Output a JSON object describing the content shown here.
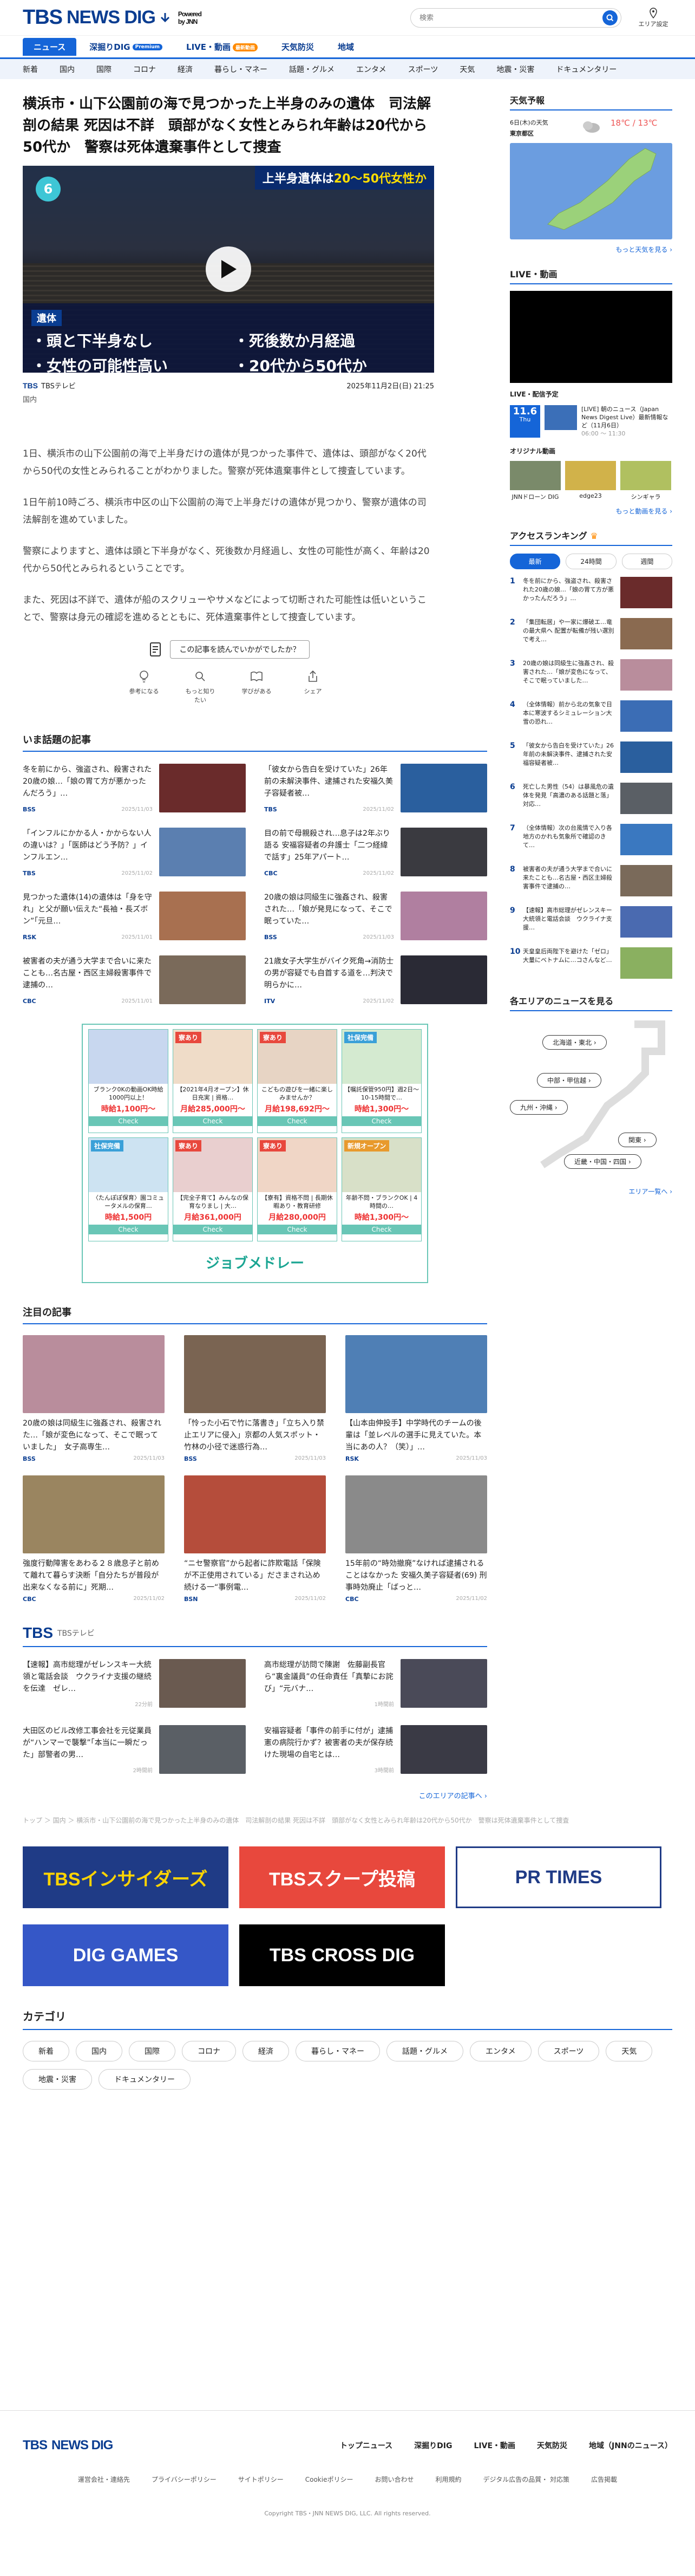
{
  "header": {
    "logo_tbs": "TBS",
    "logo_news": "NEWS DIG",
    "powered": "Powered\nby JNN",
    "search_placeholder": "検索",
    "area_label": "エリア設定"
  },
  "main_nav": [
    {
      "label": "ニュース",
      "active": true
    },
    {
      "label": "深掘りDIG",
      "tag": "Premium",
      "tag_color": "blue"
    },
    {
      "label": "LIVE・動画",
      "tag": "最新動画",
      "tag_color": "orange"
    },
    {
      "label": "天気防災"
    },
    {
      "label": "地域"
    }
  ],
  "sub_nav": [
    "新着",
    "国内",
    "国際",
    "コロナ",
    "経済",
    "暮らし・マネー",
    "話題・グルメ",
    "エンタメ",
    "スポーツ",
    "天気",
    "地震・災害",
    "ドキュメンタリー"
  ],
  "article": {
    "title": "横浜市・山下公園前の海で見つかった上半身のみの遺体　司法解剖の結果 死因は不詳　頭部がなく女性とみられ年齢は20代から50代か　警察は死体遺棄事件として捜査",
    "video": {
      "channel_badge": "6",
      "ticker_pre": "上半身遺体は",
      "ticker_hl": "20～50代女性か",
      "caption_label": "遺体",
      "caption_items": [
        "・頭と下半身なし",
        "・死後数か月経過",
        "・女性の可能性高い",
        "・20代から50代か"
      ]
    },
    "source": "TBS",
    "source_name": "TBSテレビ",
    "datetime": "2025年11月2日(日) 21:25",
    "category": "国内",
    "paragraphs": [
      "1日、横浜市の山下公園前の海で上半身だけの遺体が見つかった事件で、遺体は、頭部がなく20代から50代の女性とみられることがわかりました。警察が死体遺棄事件として捜査しています。",
      "1日午前10時ごろ、横浜市中区の山下公園前の海で上半身だけの遺体が見つかり、警察が遺体の司法解剖を進めていました。",
      "警察によりますと、遺体は頭と下半身がなく、死後数か月経過し、女性の可能性が高く、年齢は20代から50代とみられるということです。",
      "また、死因は不詳で、遺体が船のスクリューやサメなどによって切断された可能性は低いということで、警察は身元の確認を進めるとともに、死体遺棄事件として捜査しています。"
    ],
    "feedback_q": "この記事を読んでいかがでしたか？",
    "feedback_opts": [
      "参考になる",
      "もっと知りたい",
      "学びがある",
      "シェア"
    ]
  },
  "hot_topics": {
    "heading": "いま話題の記事",
    "items": [
      {
        "text": "冬を前にから、強盗され、殺害された20歳の娘…「娘の胃て方が悪かったんだろう」…",
        "src": "BSS",
        "date": "2025/11/03",
        "color": "#6a2b2b"
      },
      {
        "text": "「彼女から告白を受けていた」26年前の未解決事件、逮捕された安福久美子容疑者被…",
        "src": "TBS",
        "date": "2025/11/02",
        "color": "#2a5f9e"
      },
      {
        "text": "「インフルにかかる人・かからない人の違いは？」「医師はどう予防？」インフルエン…",
        "src": "TBS",
        "date": "2025/11/02",
        "color": "#5b7fb0"
      },
      {
        "text": "目の前で母親殺され…息子は2年ぶり語る 安福容疑者の弁護士「二つ経緯で話す」25年アパート…",
        "src": "CBC",
        "date": "2025/11/02",
        "color": "#3a3a40"
      },
      {
        "text": "見つかった遺体(14)の遺体は「身を守れ」と父が願い伝えた“長袖・長ズボン”「元旦…",
        "src": "RSK",
        "date": "2025/11/01",
        "color": "#a87050"
      },
      {
        "text": "20歳の娘は同級生に強姦され、殺害された…「娘が発見になって、そこで眠っていた…",
        "src": "BSS",
        "date": "2025/11/03",
        "color": "#b07fa0"
      },
      {
        "text": "被害者の夫が通う大学まで合いに来たことも…名古屋・西区主婦殺害事件で逮捕の…",
        "src": "CBC",
        "date": "2025/11/01",
        "color": "#7a6a5a"
      },
      {
        "text": "21歳女子大学生がバイク死角→消防士の男が容疑でも自首する道を…判決で明らかに…",
        "src": "ITV",
        "date": "2025/11/02",
        "color": "#2a2a35"
      }
    ]
  },
  "ad": {
    "items": [
      {
        "badge": "",
        "desc": "ブランク0Kの動画OK時給1000円以上！",
        "price": "時給1,100円～",
        "check": "Check",
        "color": "#c8d7ef"
      },
      {
        "badge": "寮あり",
        "desc": "【2021年4月オープン】休日充実 | 資格…",
        "price": "月給285,000円～",
        "check": "Check",
        "color": "#efdcc8"
      },
      {
        "badge": "寮あり",
        "desc": "こどもの遊びを一緒に楽しみませんか？",
        "price": "月給198,692円～",
        "check": "Check",
        "color": "#e7d4c4"
      },
      {
        "badge": "社保完備",
        "desc": "【嘱託保管950円】週2日～ 10-15時間で…",
        "price": "時給1,300円～",
        "check": "Check",
        "color": "#d4ead0"
      },
      {
        "badge": "社保完備",
        "desc": "〈たんぽぽ保育〉園コミュータメルの保育…",
        "price": "時給1,500円",
        "check": "Check",
        "color": "#cde3f2"
      },
      {
        "badge": "寮あり",
        "desc": "【完全子育て】みんなの保育なりまし | 大…",
        "price": "月給361,000円",
        "check": "Check",
        "color": "#e9cfcf"
      },
      {
        "badge": "寮あり",
        "desc": "【寮有】資格不問 | 長期休暇あり・教育研修",
        "price": "月給280,000円",
        "check": "Check",
        "color": "#f0d6c6"
      },
      {
        "badge": "新規オープン",
        "desc": "年齢不問・ブランクOK | 4時間の…",
        "price": "時給1,300円～",
        "check": "Check",
        "color": "#d8e0c8"
      }
    ],
    "logo": "ジョブメドレー"
  },
  "featured": {
    "heading": "注目の記事",
    "items": [
      {
        "text": "20歳の娘は同級生に強姦され、殺害された…「娘が変色になって、そこで眠っていました」　女子高専生…",
        "src": "BSS",
        "date": "2025/11/03",
        "color": "#b98d9c"
      },
      {
        "text": "「怜った小石で竹に落書き」「立ち入り禁止エリアに侵入」京都の人気スポット・竹林の小径で迷惑行為…",
        "src": "BSS",
        "date": "2025/11/03",
        "color": "#7a6452"
      },
      {
        "text": "【山本由伸投手】中学時代のチームの後輩は「並レベルの選手に見えていた。本当にあの人？（笑）」…",
        "src": "RSK",
        "date": "2025/11/03",
        "color": "#4f7fb5"
      },
      {
        "text": "強度行動障害をあわる２８歳息子と前めて離れて暮らす決断「自分たちが普段が出来なくなる前に」死期…",
        "src": "CBC",
        "date": "2025/11/02",
        "color": "#9a8560"
      },
      {
        "text": "“ニセ警察官”から起者に詐欺電話「保険が不正使用されている」ださまされ込め続ける一“事例電…",
        "src": "BSN",
        "date": "2025/11/02",
        "color": "#b54d3b"
      },
      {
        "text": "15年前の“時効撤廃”なければ逮捕されることはなかった 安福久美子容疑者(69) 刑事時効廃止「ばっと…",
        "src": "CBC",
        "date": "2025/11/02",
        "color": "#8a8a8a"
      }
    ]
  },
  "tbs_section": {
    "logo": "TBS",
    "sub": "TBSテレビ",
    "items": [
      {
        "text": "【速報】高市総理がゼレンスキー大統領と電話会談　ウクライナ支援の継続を伝達　ゼレ…",
        "date": "22分前",
        "color": "#6a5a50"
      },
      {
        "text": "高市総理が訪問で陳謝　佐藤副長官ら“裏金議員”の任命責任「真摯にお詫び」“元バナ…",
        "date": "1時間前",
        "color": "#4a4a58"
      },
      {
        "text": "大田区のビル改修工事会社を元従業員が“ハンマーで襲撃”「本当に一瞬だった」部警者の男…",
        "date": "2時間前",
        "color": "#5a5f65"
      },
      {
        "text": "安福容疑者「事件の前手に付が」逮捕憲の病院行かず？被害者の夫が保存続けた現場の自宅とは…",
        "date": "3時間前",
        "color": "#3a3a45"
      }
    ],
    "more": "このエリアの記事へ ›"
  },
  "breadcrumb": "トップ ＞ 国内 ＞ 横浜市・山下公園前の海で見つかった上半身のみの遺体　司法解剖の結果 死因は不詳　頭部がなく女性とみられ年齢は20代から50代か　警察は死体遺棄事件として捜査",
  "banners": [
    {
      "label": "TBSインサイダーズ",
      "bg": "#1f3b86",
      "fg": "#ffd400"
    },
    {
      "label": "TBSスクープ投稿",
      "bg": "#e8483d",
      "fg": "#ffffff"
    },
    {
      "label": "PR TIMES",
      "bg": "#ffffff",
      "fg": "#1f3b86"
    },
    {
      "label": "DIG GAMES",
      "bg": "#3557c7",
      "fg": "#ffffff"
    },
    {
      "label": "TBS CROSS DIG",
      "bg": "#000000",
      "fg": "#ffffff"
    }
  ],
  "categories": {
    "heading": "カテゴリ",
    "chips": [
      "新着",
      "国内",
      "国際",
      "コロナ",
      "経済",
      "暮らし・マネー",
      "話題・グルメ",
      "エンタメ",
      "スポーツ",
      "天気",
      "地震・災害",
      "ドキュメンタリー"
    ]
  },
  "footer": {
    "logo_tbs": "TBS",
    "logo_news": "NEWS DIG",
    "links": [
      "トップニュース",
      "深掘りDIG",
      "LIVE・動画",
      "天気防災",
      "地域（JNNのニュース）"
    ],
    "links2": [
      "運営会社・連絡先",
      "プライバシーポリシー",
      "サイトポリシー",
      "Cookieポリシー",
      "お問い合わせ",
      "利用規約",
      "デジタル広告の品質・ 対応策",
      "広告掲載"
    ],
    "copyright": "Copyright TBS・JNN NEWS DIG, LLC. All rights reserved."
  },
  "side": {
    "weather": {
      "heading": "天気予報",
      "date": "6日(木)の天気",
      "region": "東京都区",
      "temps": "18℃ / 13℃",
      "more": "もっと天気を見る ›"
    },
    "live": {
      "heading": "LIVE・動画",
      "sched_label": "LIVE・配信予定",
      "item_date": "11.6",
      "item_day": "Thu",
      "item_text": "[LIVE] 朝のニュース（Japan News Digest Live）最新情報など（11月6日）",
      "item_time": "06:00 ～ 11:30",
      "orig_heading": "オリジナル動画",
      "orig": [
        "JNNドローン DIG",
        "edge23",
        "シンギャラ"
      ],
      "more": "もっと動画を見る ›"
    },
    "ranking": {
      "heading": "アクセスランキング",
      "tabs": [
        "最新",
        "24時間",
        "週間"
      ],
      "items": [
        {
          "n": "1",
          "t": "冬を前にから、強盗され、殺害された20歳の娘…「娘の胃て方が悪かったんだろう」…",
          "c": "#6a2b2b"
        },
        {
          "n": "2",
          "t": "「集団転居」や一家に爆破エ…竜の最大県へ 配置が転備が残い選別で考え…",
          "c": "#8a6a50"
        },
        {
          "n": "3",
          "t": "20歳の娘は同級生に強姦され、殺害された…「娘が変色になって、そこで眠っていました…",
          "c": "#b98d9c"
        },
        {
          "n": "4",
          "t": "（全体情報）前から北の気象で日本に寒波するシミュレーション大雪の恐れ…",
          "c": "#3b6db5"
        },
        {
          "n": "5",
          "t": "「彼女から告白を受けていた」26年前の未解決事件、逮捕された安福容疑者被…",
          "c": "#2a5f9e"
        },
        {
          "n": "6",
          "t": "死亡した男性（54）は暴風危の遺体を発見「高濃のある話題と落」対応…",
          "c": "#5a5f65"
        },
        {
          "n": "7",
          "t": "（全体情報）次の台風情で入り各地方のかれも気象所で確認のきて…",
          "c": "#3a78c0"
        },
        {
          "n": "8",
          "t": "被害者の夫が通う大学まで合いに来たことも…名古屋・西区主婦殺害事件で逮捕の…",
          "c": "#7a6a5a"
        },
        {
          "n": "9",
          "t": "【速報】高市総理がゼレンスキー大統領と電話会談　ウクライナ支援…",
          "c": "#4a6ab0"
        },
        {
          "n": "10",
          "t": "天皇皇后両陛下を避けた「ゼロ」大量にベトナムに…コさんなど…",
          "c": "#8ab060"
        }
      ]
    },
    "region": {
      "heading": "各エリアのニュースを見る",
      "buttons": [
        "北海道・東北 ›",
        "中部・甲信越 ›",
        "九州・沖縄 ›",
        "関東 ›",
        "中国・四国 ›",
        "近畿・中国・四国 ›"
      ],
      "more": "エリア一覧へ ›"
    }
  },
  "colors": {
    "brand": "#0a3d91",
    "accent": "#1565d8",
    "orange": "#ff8a00"
  }
}
